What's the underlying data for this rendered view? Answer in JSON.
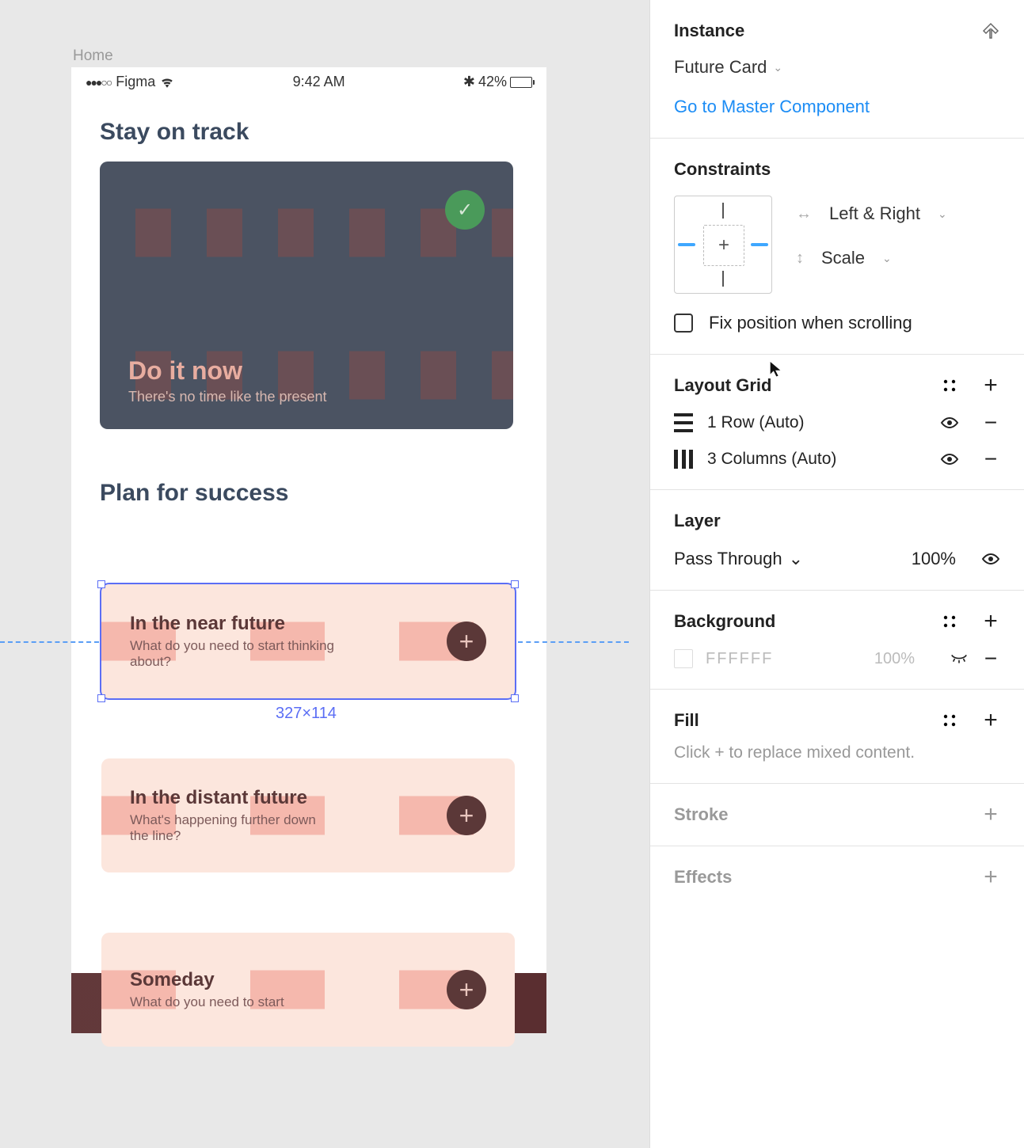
{
  "frame_label": "Home",
  "status_bar": {
    "carrier": "Figma",
    "time": "9:42 AM",
    "battery": "42%"
  },
  "sections": {
    "track": {
      "title": "Stay on track",
      "card_title": "Do it now",
      "card_sub": "There's no time like the present"
    },
    "plan": {
      "title": "Plan for success",
      "cards": [
        {
          "title": "In the near future",
          "sub": "What do you need to start thinking about?"
        },
        {
          "title": "In the distant future",
          "sub": "What's happening further down the line?"
        },
        {
          "title": "Someday",
          "sub": "What do you need to start"
        }
      ]
    }
  },
  "selection_dims": "327×114",
  "panel": {
    "instance": {
      "title": "Instance",
      "name": "Future Card",
      "master_link": "Go to Master Component"
    },
    "constraints": {
      "title": "Constraints",
      "horizontal": "Left & Right",
      "vertical": "Scale",
      "fix_label": "Fix position when scrolling"
    },
    "layout_grid": {
      "title": "Layout Grid",
      "rows": [
        {
          "label": "1 Row (Auto)"
        },
        {
          "label": "3 Columns (Auto)"
        }
      ]
    },
    "layer": {
      "title": "Layer",
      "blend": "Pass Through",
      "opacity": "100%"
    },
    "background": {
      "title": "Background",
      "hex": "FFFFFF",
      "opacity": "100%"
    },
    "fill": {
      "title": "Fill",
      "hint": "Click + to replace mixed content."
    },
    "stroke": {
      "title": "Stroke"
    },
    "effects": {
      "title": "Effects"
    }
  }
}
